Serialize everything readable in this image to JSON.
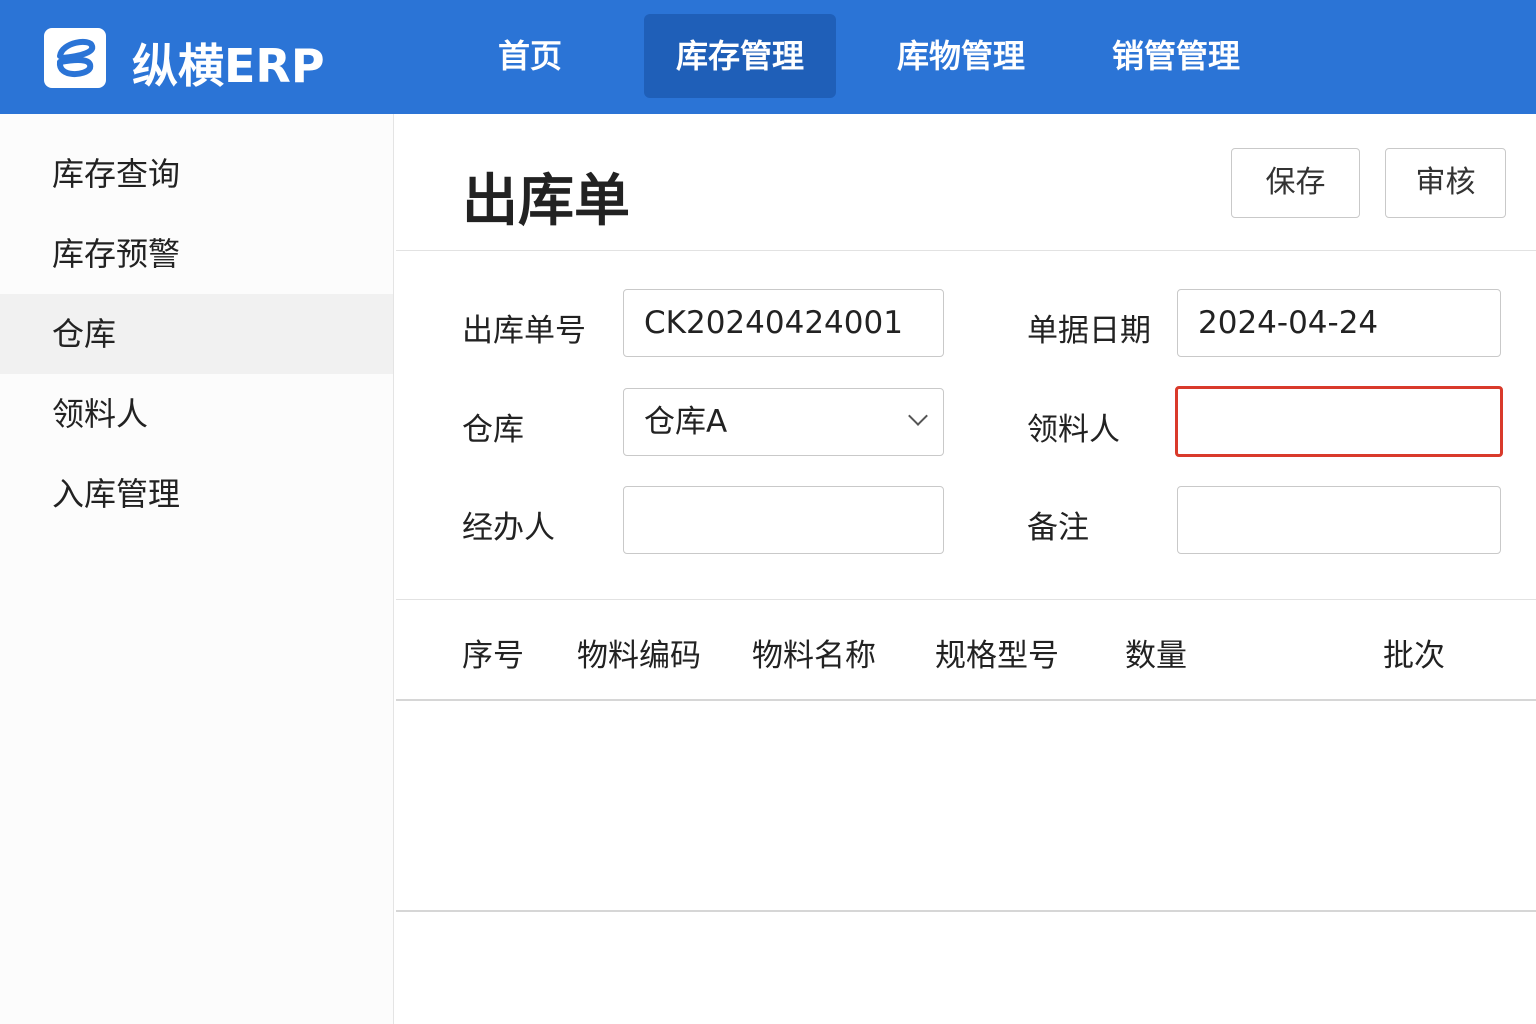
{
  "header": {
    "brand": "纵横ERP",
    "nav": [
      {
        "label": "首页"
      },
      {
        "label": "库存管理",
        "active": true
      },
      {
        "label": "库物管理"
      },
      {
        "label": "销管管理"
      }
    ]
  },
  "sidebar": {
    "items": [
      {
        "label": "库存查询"
      },
      {
        "label": "库存预警"
      },
      {
        "label": "仓库",
        "active": true
      },
      {
        "label": "领料人"
      },
      {
        "label": "入库管理"
      }
    ]
  },
  "page": {
    "title": "出库单",
    "save_label": "保存",
    "review_label": "审核"
  },
  "form": {
    "order_no": {
      "label": "出库单号",
      "value": "CK20240424001"
    },
    "date": {
      "label": "单据日期",
      "value": "2024-04-24"
    },
    "warehouse": {
      "label": "仓库",
      "value": "仓库A"
    },
    "picker": {
      "label": "领料人",
      "value": ""
    },
    "handler": {
      "label": "经办人",
      "value": ""
    },
    "remark": {
      "label": "备注",
      "value": ""
    }
  },
  "table": {
    "columns": [
      "序号",
      "物料编码",
      "物料名称",
      "规格型号",
      "数量",
      "批次"
    ]
  },
  "colors": {
    "primary": "#2b74d6",
    "error": "#d93a2b"
  }
}
